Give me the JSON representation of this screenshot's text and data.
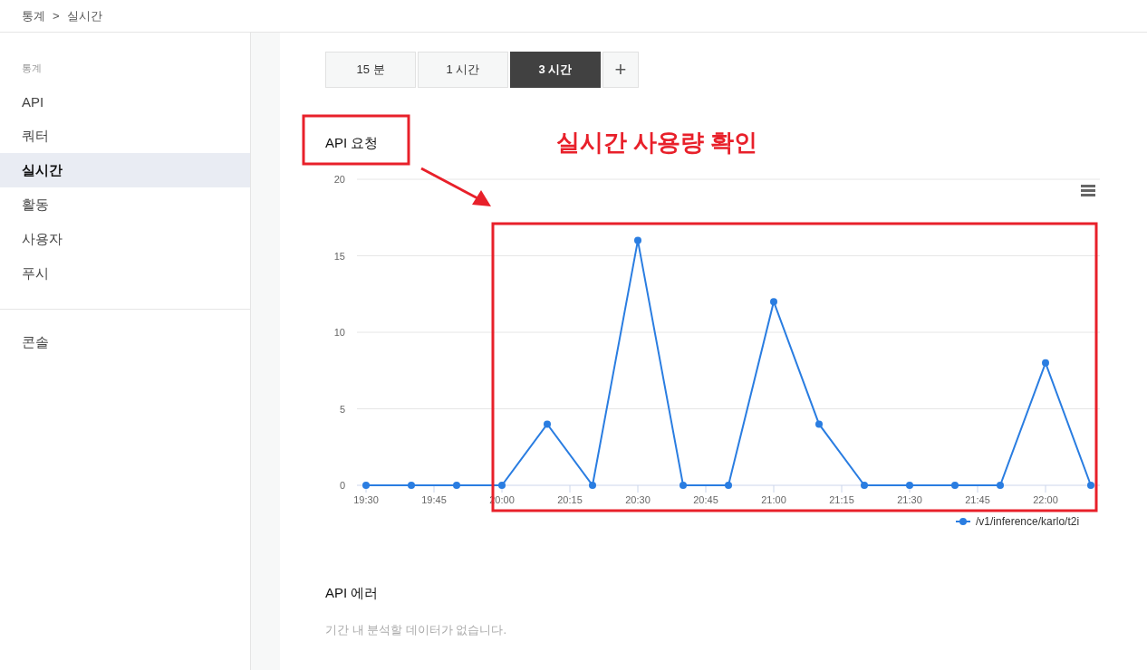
{
  "breadcrumb": [
    "통계",
    ">",
    "실시간"
  ],
  "sidebar": {
    "section": "통계",
    "items": [
      {
        "label": "API",
        "selected": false
      },
      {
        "label": "쿼터",
        "selected": false
      },
      {
        "label": "실시간",
        "selected": true
      },
      {
        "label": "활동",
        "selected": false
      },
      {
        "label": "사용자",
        "selected": false
      },
      {
        "label": "푸시",
        "selected": false
      }
    ],
    "footer_items": [
      {
        "label": "콘솔",
        "selected": false
      }
    ]
  },
  "range_tabs": [
    {
      "label": "15 분",
      "selected": false
    },
    {
      "label": "1 시간",
      "selected": false
    },
    {
      "label": "3 시간",
      "selected": true
    }
  ],
  "add_button": {
    "label": "+"
  },
  "requests_panel": {
    "chart_data": {
      "type": "line",
      "title": "API 요청",
      "x": [
        1170,
        1180,
        1190,
        1200,
        1210,
        1220,
        1230,
        1240,
        1250,
        1260,
        1270,
        1280,
        1290,
        1300,
        1310,
        1320,
        1330
      ],
      "grid": true,
      "series": [
        {
          "name": "/v1/inference/karlo/t2i",
          "color": "#2a7de1",
          "marker": true,
          "values": [
            0,
            0,
            0,
            0,
            4,
            0,
            16,
            0,
            0,
            12,
            4,
            0,
            0,
            0,
            0,
            8,
            0
          ]
        }
      ],
      "xlim": [
        1168,
        1332
      ],
      "ylim": [
        0,
        20
      ],
      "xticks": [
        {
          "value": 1170,
          "label": "19:30"
        },
        {
          "value": 1185,
          "label": "19:45"
        },
        {
          "value": 1200,
          "label": "20:00"
        },
        {
          "value": 1215,
          "label": "20:15"
        },
        {
          "value": 1230,
          "label": "20:30"
        },
        {
          "value": 1245,
          "label": "20:45"
        },
        {
          "value": 1260,
          "label": "21:00"
        },
        {
          "value": 1275,
          "label": "21:15"
        },
        {
          "value": 1290,
          "label": "21:30"
        },
        {
          "value": 1305,
          "label": "21:45"
        },
        {
          "value": 1320,
          "label": "22:00"
        }
      ],
      "yticks": [
        0,
        5,
        10,
        15,
        20
      ]
    }
  },
  "annotation": {
    "text": "실시간 사용량 확인"
  },
  "errors_panel": {
    "title": "API 에러",
    "message": "기간 내 분석할 데이터가 없습니다."
  }
}
